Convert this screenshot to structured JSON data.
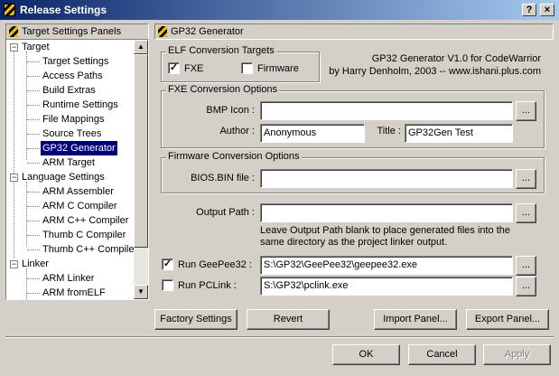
{
  "window": {
    "title": "Release Settings",
    "help": "?",
    "close": "×"
  },
  "left": {
    "header": "Target Settings Panels",
    "groups": [
      {
        "label": "Target",
        "expander": "−",
        "items": [
          "Target Settings",
          "Access Paths",
          "Build Extras",
          "Runtime Settings",
          "File Mappings",
          "Source Trees",
          "GP32 Generator",
          "ARM Target"
        ]
      },
      {
        "label": "Language Settings",
        "expander": "−",
        "items": [
          "ARM Assembler",
          "ARM C Compiler",
          "ARM C++ Compiler",
          "Thumb C Compiler",
          "Thumb C++ Compiler"
        ]
      },
      {
        "label": "Linker",
        "expander": "−",
        "items": [
          "ARM Linker",
          "ARM fromELF"
        ]
      }
    ],
    "selected": "GP32 Generator",
    "scroll": {
      "up": "▲",
      "down": "▼"
    }
  },
  "panel": {
    "header": "GP32 Generator",
    "elf": {
      "title": "ELF Conversion Targets",
      "fxe": {
        "label": "FXE",
        "checked": "✓"
      },
      "firmware": {
        "label": "Firmware",
        "checked": ""
      }
    },
    "about": {
      "line1": "GP32 Generator V1.0 for CodeWarrior",
      "line2": "by Harry Denholm, 2003 -- www.ishani.plus.com"
    },
    "fxe_options": {
      "title": "FXE Conversion Options",
      "bmp_label": "BMP Icon :",
      "bmp_value": "",
      "author_label": "Author :",
      "author_value": "Anonymous",
      "title_label": "Title :",
      "title_value": "GP32Gen Test"
    },
    "fw_options": {
      "title": "Firmware Conversion Options",
      "bios_label": "BIOS.BIN file :",
      "bios_value": ""
    },
    "output": {
      "label": "Output Path :",
      "value": "",
      "hint1": "Leave Output Path blank to place generated files into the",
      "hint2": "same directory as the project linker output."
    },
    "geepee": {
      "label": "Run GeePee32 :",
      "checked": "✓",
      "value": "S:\\GP32\\GeePee32\\geepee32.exe"
    },
    "pclink": {
      "label": "Run PCLink :",
      "checked": "",
      "value": "S:\\GP32\\pclink.exe"
    },
    "browse": "...",
    "buttons": {
      "factory": "Factory Settings",
      "revert": "Revert",
      "import": "Import Panel...",
      "export": "Export Panel..."
    }
  },
  "footer": {
    "ok": "OK",
    "cancel": "Cancel",
    "apply": "Apply"
  }
}
